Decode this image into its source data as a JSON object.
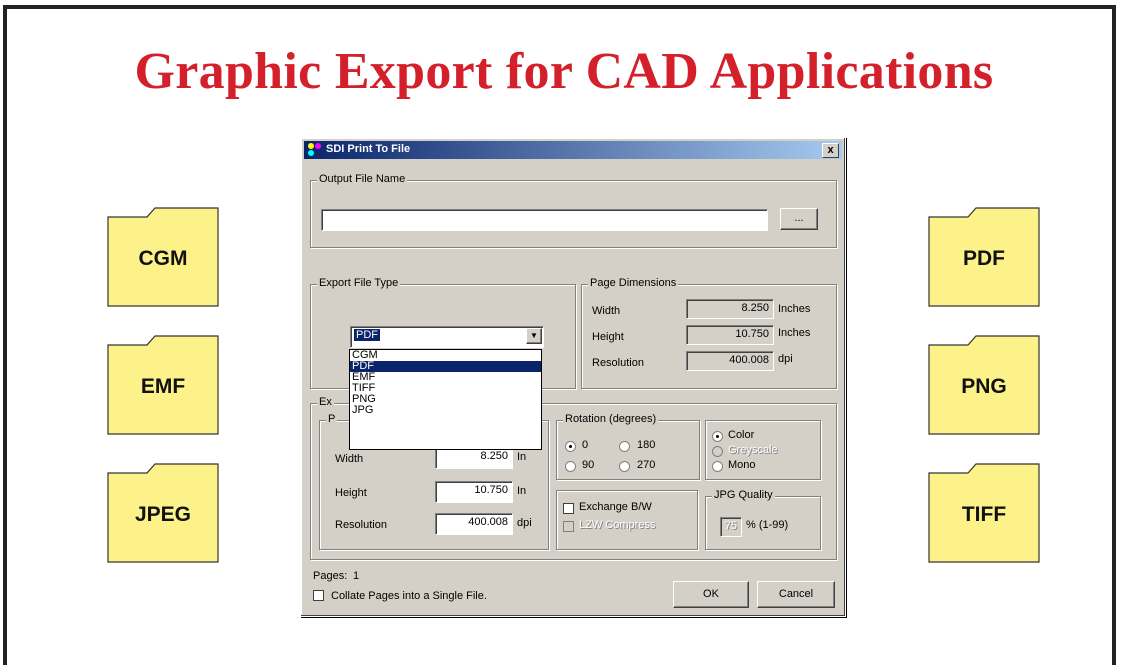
{
  "slide": {
    "title": "Graphic Export for CAD Applications"
  },
  "formats_left": [
    "CGM",
    "EMF",
    "JPEG"
  ],
  "formats_right": [
    "PDF",
    "PNG",
    "TIFF"
  ],
  "colors": {
    "title": "#d4202a",
    "folder_fill": "#fdf28a",
    "titlebar": "#0a246a"
  },
  "dialog": {
    "title": "SDI Print To File",
    "close_label": "x",
    "output": {
      "group_label": "Output File Name",
      "value": "",
      "browse_label": "..."
    },
    "export_type": {
      "group_label": "Export File Type",
      "selected": "PDF",
      "options": [
        "CGM",
        "PDF",
        "EMF",
        "TIFF",
        "PNG",
        "JPG"
      ]
    },
    "page_dims": {
      "group_label": "Page Dimensions",
      "width_label": "Width",
      "width_value": "8.250",
      "width_unit": "Inches",
      "height_label": "Height",
      "height_value": "10.750",
      "height_unit": "Inches",
      "res_label": "Resolution",
      "res_value": "400.008",
      "res_unit": "dpi"
    },
    "export": {
      "group_label": "Ex",
      "sub_label": "P",
      "width_label": "Width",
      "width_value": "8.250",
      "width_unit": "In",
      "height_label": "Height",
      "height_value": "10.750",
      "height_unit": "In",
      "res_label": "Resolution",
      "res_value": "400.008",
      "res_unit": "dpi"
    },
    "rotation": {
      "group_label": "Rotation (degrees)",
      "options": [
        "0",
        "180",
        "90",
        "270"
      ],
      "selected": "0"
    },
    "color_mode": {
      "options": [
        "Color",
        "Greyscale",
        "Mono"
      ],
      "selected": "Color"
    },
    "exchange_bw_label": "Exchange B/W",
    "lzw_label": "LZW Compress",
    "jpg_quality": {
      "group_label": "JPG Quality",
      "value": "75",
      "range_label": "% (1-99)"
    },
    "pages_label": "Pages:",
    "pages_value": "1",
    "collate_label": "Collate Pages into a Single File.",
    "ok_label": "OK",
    "cancel_label": "Cancel"
  }
}
